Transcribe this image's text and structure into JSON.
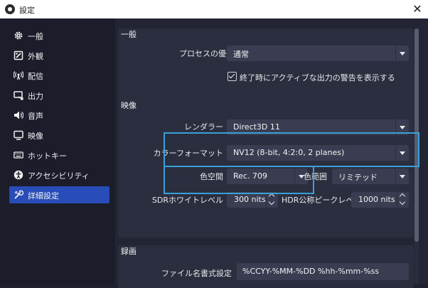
{
  "window": {
    "title": "設定"
  },
  "sidebar": {
    "items": [
      {
        "label": "一般",
        "icon": "gear-icon"
      },
      {
        "label": "外観",
        "icon": "palette-icon"
      },
      {
        "label": "配信",
        "icon": "broadcast-icon"
      },
      {
        "label": "出力",
        "icon": "output-icon"
      },
      {
        "label": "音声",
        "icon": "speaker-icon"
      },
      {
        "label": "映像",
        "icon": "monitor-icon"
      },
      {
        "label": "ホットキー",
        "icon": "keyboard-icon"
      },
      {
        "label": "アクセシビリティ",
        "icon": "accessibility-icon"
      },
      {
        "label": "詳細設定",
        "icon": "wrench-icon"
      }
    ],
    "selected": "詳細設定"
  },
  "general": {
    "title": "一般",
    "priority_label": "プロセスの優先度",
    "priority_value": "通常",
    "exit_warning_label": "終了時にアクティブな出力の警告を表示する",
    "exit_warning_checked": true
  },
  "video": {
    "title": "映像",
    "renderer_label": "レンダラー",
    "renderer_value": "Direct3D 11",
    "color_format_label": "カラーフォーマット",
    "color_format_value": "NV12 (8-bit, 4:2:0, 2 planes)",
    "color_space_label": "色空間",
    "color_space_value": "Rec. 709",
    "color_range_label": "色範囲",
    "color_range_value": "リミテッド",
    "sdr_label": "SDRホワイトレベル",
    "sdr_value": "300 nits",
    "hdr_label": "HDR公称ピークレベル",
    "hdr_value": "1000 nits"
  },
  "recording": {
    "title": "録画",
    "filename_label": "ファイル名書式設定",
    "filename_value": "%CCYY-%MM-%DD %hh-%mm-%ss"
  },
  "colors": {
    "selected_nav": "#284cb8",
    "highlight_box": "#3aa0d8",
    "panel_bg": "#2b2e3f",
    "control_bg": "#3a3d51"
  }
}
